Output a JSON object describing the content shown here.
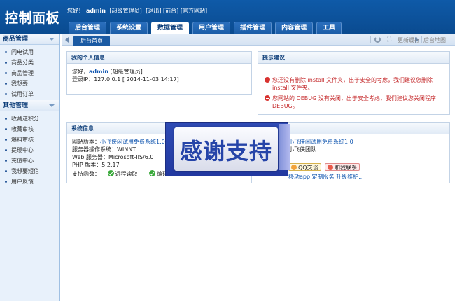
{
  "header": {
    "logo": "控制面板",
    "greeting": "您好！",
    "username": "admin",
    "role": "[超级管理员]",
    "links": [
      "[退出]",
      "[前台]",
      "[官方网站]"
    ]
  },
  "nav": [
    "后台管理",
    "系统设置",
    "数据管理",
    "用户管理",
    "插件管理",
    "内容管理",
    "工具"
  ],
  "nav_active": "数据管理",
  "sidebar": {
    "sections": [
      {
        "title": "商品管理",
        "items": [
          "闪电试用",
          "商品分类",
          "商品管理",
          "我想要",
          "试用订单"
        ]
      },
      {
        "title": "其他管理",
        "items": [
          "收藏送积分",
          "收藏审核",
          "爆料审核",
          "提现中心",
          "充值中心",
          "我想要短信",
          "用户反馈"
        ]
      }
    ]
  },
  "strip": {
    "home_tab": "后台首页",
    "clear_cache": "更新缓存",
    "sitemap": "后台地图"
  },
  "personal": {
    "title": "我的个人信息",
    "hello": "您好，",
    "user": "admin",
    "role": "[超级管理员]",
    "login_label": "登录IP：",
    "login_value": "127.0.0.1 [ 2014-11-03 14:17]"
  },
  "tips": {
    "title": "提示建议",
    "items": [
      "您还没有删除 install 文件夹，出于安全的考虑，我们建议您删除 install 文件夹。",
      "您网站的 DEBUG 没有关闭，出于安全考虑，我们建议您关闭程序 DEBUG。"
    ]
  },
  "sysinfo": {
    "title": "系统信息",
    "rows": [
      {
        "label": "网站版本：",
        "value": "小飞侠闲试用免费系统1.0"
      },
      {
        "label": "服务器操作系统：",
        "value": "WINNT"
      },
      {
        "label": "Web 服务器：",
        "value": "Microsoft-IIS/6.0"
      },
      {
        "label": "PHP 版本：",
        "value": "5.2.17"
      }
    ],
    "support_label": "支持函数：",
    "support_items": [
      "远程读取",
      "编码"
    ]
  },
  "about": {
    "product": "小飞侠闲试用免费系统1.0",
    "team": "小飞侠团队",
    "qq_label": "QQ交谈",
    "ww_label": "和我联系",
    "service": "移动app 定制服务 升级维护..."
  },
  "overlay": {
    "text": "感谢支持"
  }
}
